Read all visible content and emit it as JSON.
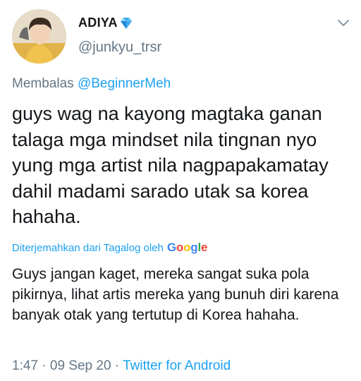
{
  "user": {
    "display_name": "ADIYA",
    "handle": "@junkyu_trsr",
    "verified_badge_icon": "blue-diamond-emoji"
  },
  "reply": {
    "prefix": "Membalas",
    "mention": "@BeginnerMeh"
  },
  "tweet": {
    "text": "guys wag na kayong magtaka ganan talaga mga mindset nila tingnan nyo yung mga artist nila nagpapakamatay dahil madami sarado utak sa korea hahaha."
  },
  "translation": {
    "label": "Diterjemahkan dari Tagalog oleh",
    "provider": "Google",
    "text": "Guys jangan kaget, mereka sangat suka pola pikirnya, lihat artis mereka yang bunuh diri karena banyak otak yang tertutup di Korea hahaha."
  },
  "meta": {
    "time": "1:47",
    "separator": " · ",
    "date": "09 Sep 20",
    "source": "Twitter for Android"
  },
  "icons": {
    "menu": "chevron-down-icon"
  },
  "colors": {
    "link": "#1da1f2",
    "secondary": "#657786",
    "text": "#14171a"
  }
}
